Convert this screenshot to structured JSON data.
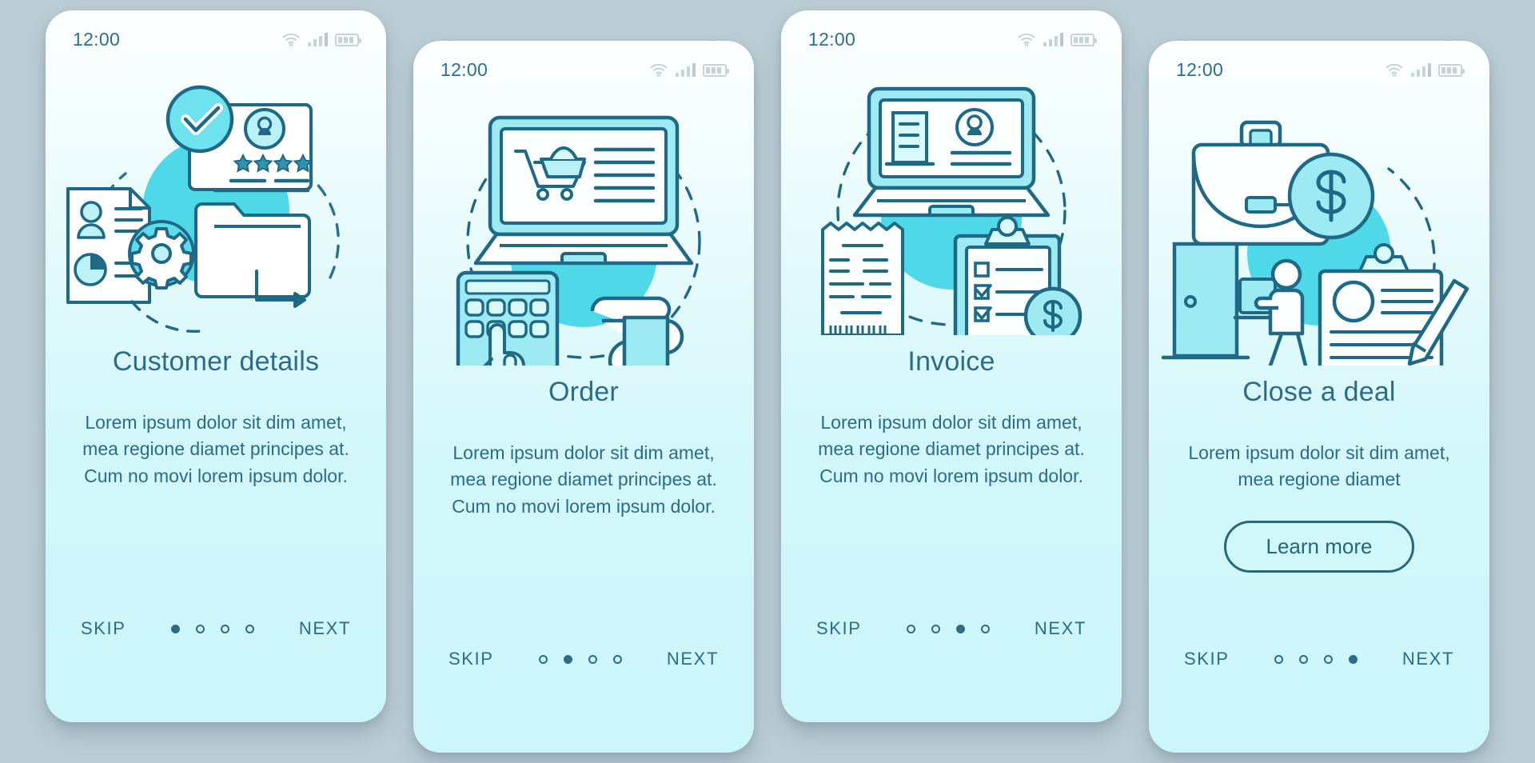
{
  "theme": {
    "page_background": "#bccdd5",
    "card_gradient_top": "#fdffff",
    "card_gradient_bottom": "#cbf6fa",
    "accent_dark": "#1e6a86",
    "accent_text": "#2b6c89",
    "accent_cyan": "#3fb8d4",
    "accent_circle": "#4fd8e8",
    "status_icon_grey": "#c6d4da"
  },
  "status_bar": {
    "time": "12:00",
    "icons": [
      "wifi-icon",
      "signal-bars-icon",
      "battery-icon"
    ]
  },
  "nav": {
    "skip_label": "SKIP",
    "next_label": "NEXT",
    "total_steps": 4
  },
  "screens": [
    {
      "id": "customer-details",
      "title": "Customer details",
      "description": "Lorem ipsum dolor sit dim amet, mea regione diamet principes at. Cum no movi lorem ipsum dolor.",
      "active_step": 1,
      "has_learn_more": false,
      "illustration": "customer-details-illustration",
      "illustration_elements": [
        "check-badge-icon",
        "id-card-icon",
        "avatar-icon",
        "star-rating-icon",
        "profile-document-icon",
        "pie-chart-icon",
        "gear-icon",
        "folder-icon",
        "arrow-icon",
        "dashed-circle"
      ]
    },
    {
      "id": "order",
      "title": "Order",
      "description": "Lorem ipsum dolor sit dim amet, mea regione diamet principes at. Cum no movi lorem ipsum dolor.",
      "active_step": 2,
      "has_learn_more": false,
      "illustration": "order-illustration",
      "illustration_elements": [
        "laptop-icon",
        "shopping-cart-icon",
        "smartphone-keypad-icon",
        "pointing-hand-icon",
        "hand-icon",
        "bookmark-icon",
        "dashed-circle"
      ]
    },
    {
      "id": "invoice",
      "title": "Invoice",
      "description": "Lorem ipsum dolor sit dim amet, mea regione diamet principes at. Cum no movi lorem ipsum dolor.",
      "active_step": 3,
      "has_learn_more": false,
      "illustration": "invoice-illustration",
      "illustration_elements": [
        "laptop-icon",
        "document-icon",
        "avatar-icon",
        "receipt-icon",
        "clipboard-checklist-icon",
        "dollar-coin-icon",
        "dashed-circle"
      ]
    },
    {
      "id": "close-a-deal",
      "title": "Close a deal",
      "description": "Lorem ipsum dolor sit dim amet, mea regione diamet",
      "active_step": 4,
      "has_learn_more": true,
      "learn_more_label": "Learn more",
      "illustration": "close-a-deal-illustration",
      "illustration_elements": [
        "briefcase-icon",
        "dollar-coin-icon",
        "door-icon",
        "walking-person-icon",
        "clipboard-contract-icon",
        "pen-icon",
        "dashed-circle"
      ]
    }
  ]
}
